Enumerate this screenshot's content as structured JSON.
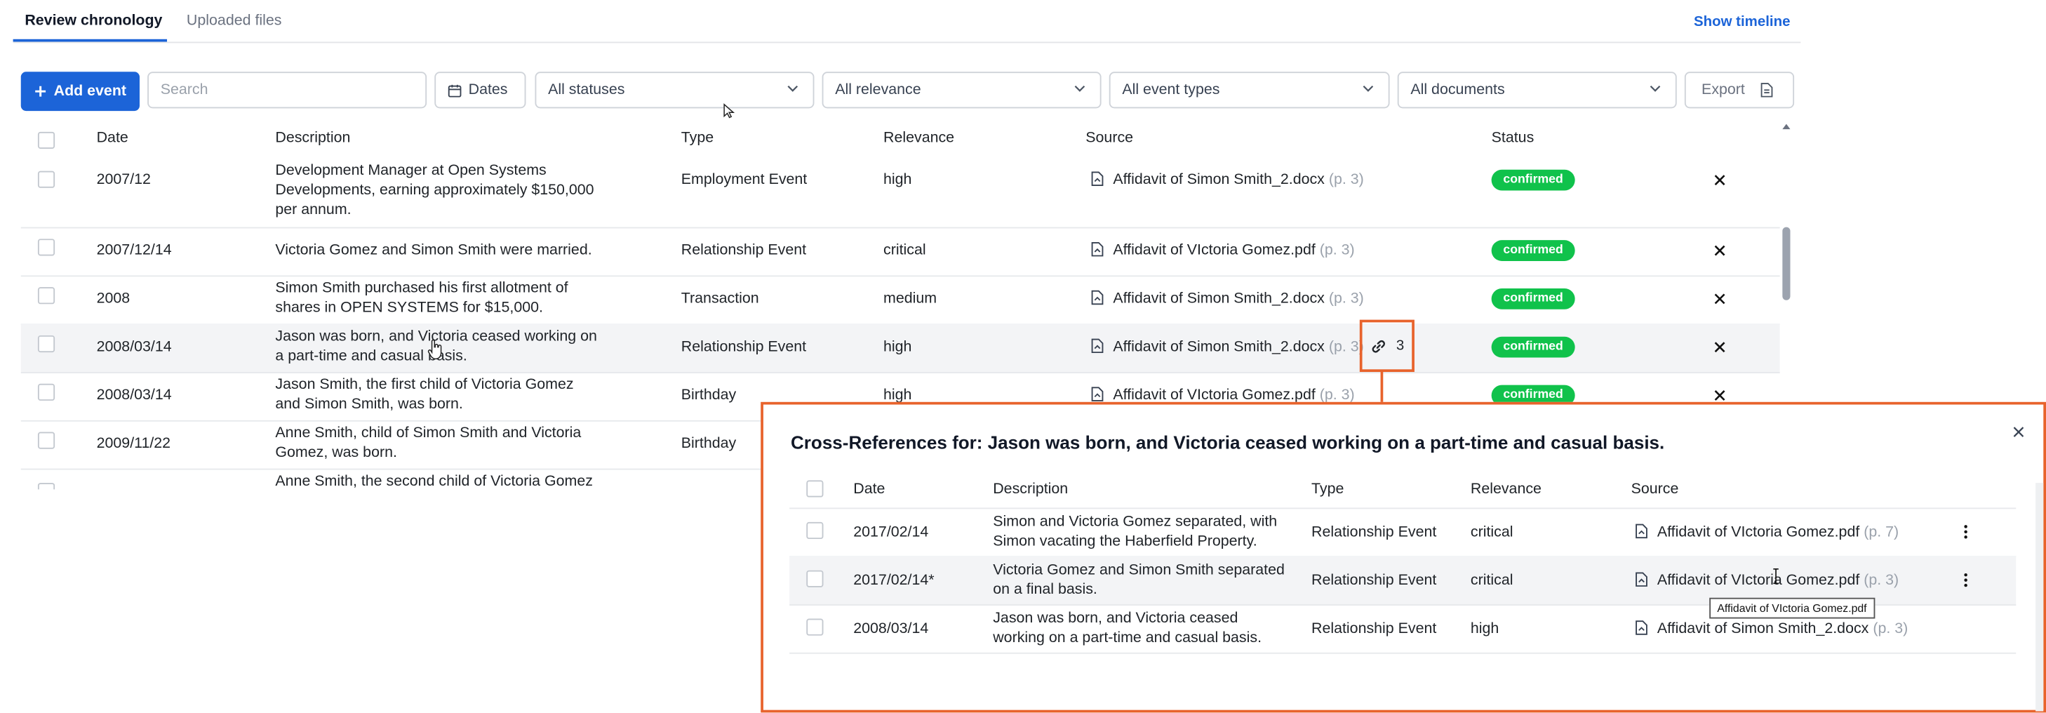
{
  "tabs": [
    {
      "label": "Review chronology",
      "active": true
    },
    {
      "label": "Uploaded files",
      "active": false
    }
  ],
  "show_timeline": "Show timeline",
  "toolbar": {
    "add_event": "Add event",
    "search_placeholder": "Search",
    "dates": "Dates",
    "statuses": "All statuses",
    "relevance": "All relevance",
    "event_types": "All event types",
    "documents": "All documents",
    "export": "Export"
  },
  "table": {
    "columns": [
      "Date",
      "Description",
      "Type",
      "Relevance",
      "Source",
      "Status"
    ],
    "rows": [
      {
        "date": "2007/12",
        "desc1": "Development Manager at Open Systems",
        "desc2": "Developments, earning approximately $150,000",
        "desc3": "per annum.",
        "type": "Employment Event",
        "relevance": "high",
        "source": "Affidavit of Simon Smith_2.docx",
        "page": "(p. 3)",
        "status": "confirmed"
      },
      {
        "date": "2007/12/14",
        "desc1": "Victoria Gomez and Simon Smith were married.",
        "desc2": "",
        "desc3": "",
        "type": "Relationship Event",
        "relevance": "critical",
        "source": "Affidavit of VIctoria Gomez.pdf",
        "page": "(p. 3)",
        "status": "confirmed"
      },
      {
        "date": "2008",
        "desc1": "Simon Smith purchased his first allotment of",
        "desc2": "shares in OPEN SYSTEMS for $15,000.",
        "desc3": "",
        "type": "Transaction",
        "relevance": "medium",
        "source": "Affidavit of Simon Smith_2.docx",
        "page": "(p. 3)",
        "status": "confirmed"
      },
      {
        "date": "2008/03/14",
        "desc1": "Jason was born, and Victoria ceased working on",
        "desc2": "a part-time and casual basis.",
        "desc3": "",
        "type": "Relationship Event",
        "relevance": "high",
        "source": "Affidavit of Simon Smith_2.docx",
        "page": "(p. 3)",
        "status": "confirmed"
      },
      {
        "date": "2008/03/14",
        "desc1": "Jason Smith, the first child of Victoria Gomez",
        "desc2": "and Simon Smith, was born.",
        "desc3": "",
        "type": "Birthday",
        "relevance": "high",
        "source": "Affidavit of VIctoria Gomez.pdf",
        "page": "(p. 3)",
        "status": "confirmed"
      },
      {
        "date": "2009/11/22",
        "desc1": "Anne Smith, child of Simon Smith and Victoria",
        "desc2": "Gomez, was born.",
        "desc3": "",
        "type": "Birthday",
        "relevance": "",
        "source": "",
        "page": "",
        "status": ""
      },
      {
        "date": "",
        "desc1": "Anne Smith, the second child of Victoria Gomez",
        "desc2": "",
        "desc3": "",
        "type": "",
        "relevance": "",
        "source": "",
        "page": "",
        "status": ""
      }
    ],
    "xref_count": "3"
  },
  "panel": {
    "title": "Cross-References for: Jason was born, and Victoria ceased working on a part-time and casual basis.",
    "columns": [
      "Date",
      "Description",
      "Type",
      "Relevance",
      "Source"
    ],
    "rows": [
      {
        "date": "2017/02/14",
        "desc1": "Simon and Victoria Gomez separated, with",
        "desc2": "Simon vacating the Haberfield Property.",
        "type": "Relationship Event",
        "relevance": "critical",
        "source": "Affidavit of VIctoria Gomez.pdf",
        "page": "(p. 7)"
      },
      {
        "date": "2017/02/14*",
        "desc1": "Victoria Gomez and Simon Smith separated",
        "desc2": "on a final basis.",
        "type": "Relationship Event",
        "relevance": "critical",
        "source": "Affidavit of VIctoria Gomez.pdf",
        "page": "(p. 3)"
      },
      {
        "date": "2008/03/14",
        "desc1": "Jason was born, and Victoria ceased",
        "desc2": "working on a part-time and casual basis.",
        "type": "Relationship Event",
        "relevance": "high",
        "source": "Affidavit of Simon Smith_2.docx",
        "page": "(p. 3)"
      }
    ],
    "tooltip": "Affidavit of VIctoria Gomez.pdf"
  },
  "colors": {
    "accent": "#1c64d8",
    "confirmed": "#10c24b",
    "highlight": "#e8632c"
  },
  "icons": [
    "plus-icon",
    "calendar-icon",
    "chevron-down-icon",
    "export-file-icon",
    "document-icon",
    "close-icon",
    "link-icon",
    "kebab-icon",
    "cursor-hand-icon",
    "cursor-arrow-icon",
    "text-cursor-icon"
  ]
}
